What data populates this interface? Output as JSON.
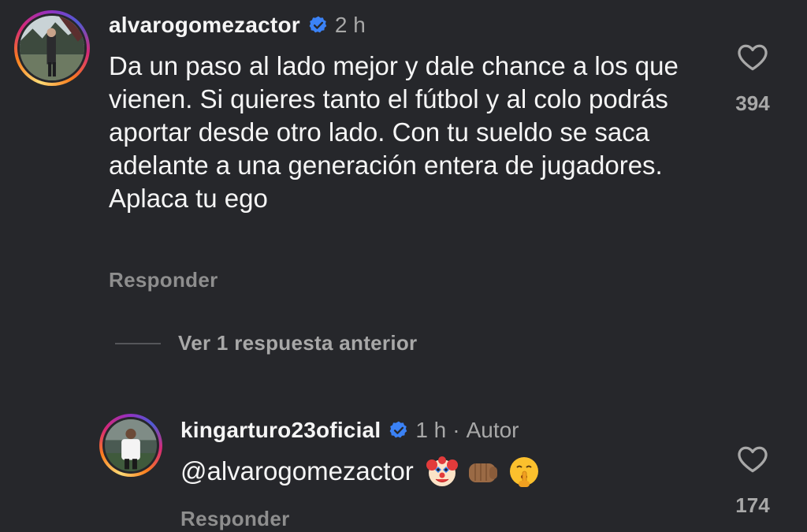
{
  "comments": [
    {
      "username": "alvarogomezactor",
      "time": "2 h",
      "text": "Da un paso al lado mejor y dale chance a los que vienen. Si quieres tanto el fútbol y al colo podrás aportar desde otro lado. Con tu sueldo se saca adelante a una generación entera de jugadores. Aplaca tu ego",
      "reply_label": "Responder",
      "like_count": "394"
    }
  ],
  "view_replies": "Ver 1 respuesta anterior",
  "reply": {
    "username": "kingarturo23oficial",
    "time": "1 h",
    "separator": "·",
    "author_badge": "Autor",
    "mention": "@alvarogomezactor",
    "emojis": [
      "clown-face",
      "oncoming-fist",
      "shushing-face"
    ],
    "reply_label": "Responder",
    "like_count": "174"
  },
  "colors": {
    "background": "#26272b",
    "verified": "#3b82f6",
    "muted": "#a8a8a8"
  }
}
